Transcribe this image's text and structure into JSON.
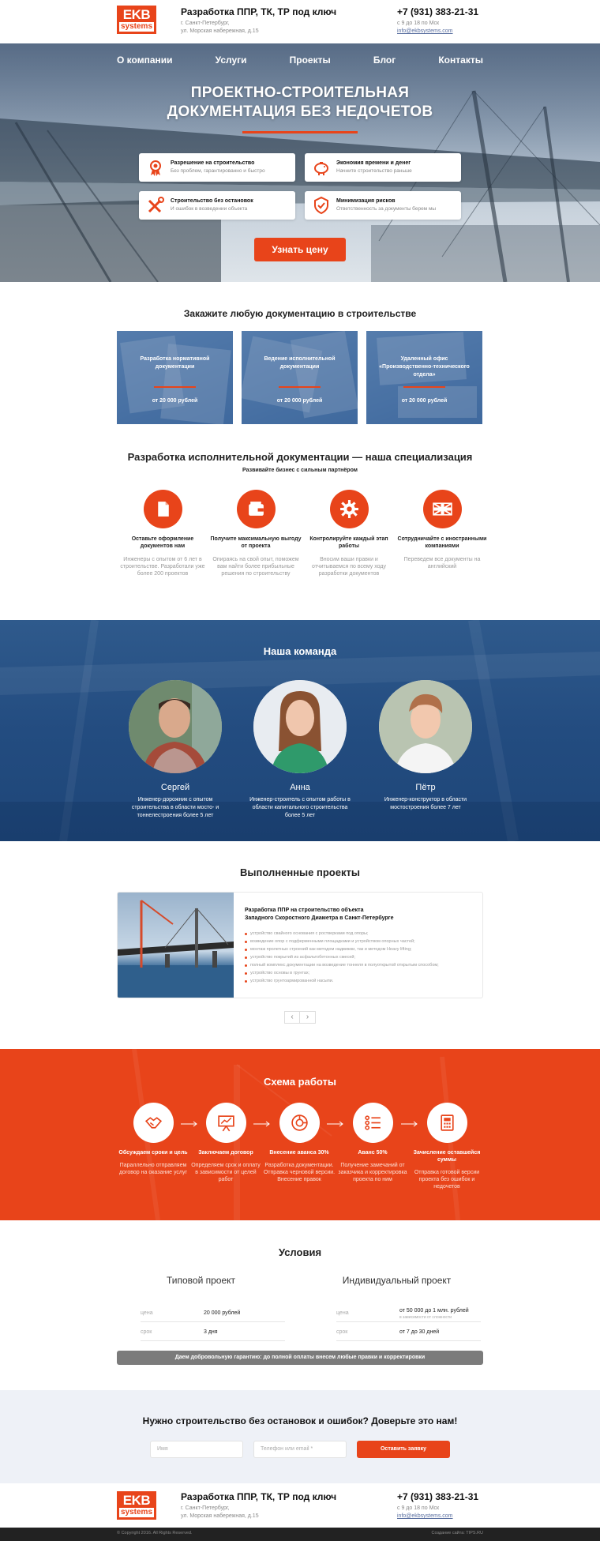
{
  "header": {
    "logo_top": "EKB",
    "logo_bottom": "systems",
    "title": "Разработка ППР, ТК, ТР под ключ",
    "city": "г. Санкт-Петербург,",
    "address": "ул. Морская набережная, д.15",
    "phone": "+7 (931) 383-21-31",
    "hours": "с 9 до 18 по Мск",
    "email": "info@ekbsystems.com"
  },
  "nav": [
    "О компании",
    "Услуги",
    "Проекты",
    "Блог",
    "Контакты"
  ],
  "hero": {
    "title_line1": "ПРОЕКТНО-СТРОИТЕЛЬНАЯ",
    "title_line2": "ДОКУМЕНТАЦИЯ БЕЗ НЕДОЧЕТОВ",
    "features": [
      {
        "title": "Разрешение на строительство",
        "sub": "Без проблем, гарантированно и быстро",
        "icon": "certificate-icon"
      },
      {
        "title": "Экономия времени и денег",
        "sub": "Начните строительство раньше",
        "icon": "piggy-bank-icon"
      },
      {
        "title": "Строительство без остановок",
        "sub": "И ошибок в возведении объекта",
        "icon": "tools-icon"
      },
      {
        "title": "Минимизация рисков",
        "sub": "Ответственность за документы берем мы",
        "icon": "shield-check-icon"
      }
    ],
    "cta": "Узнать цену"
  },
  "order": {
    "title": "Закажите любую документацию в строительстве",
    "cards": [
      {
        "name": "Разработка нормативной документации",
        "price": "от 20 000 рублей"
      },
      {
        "name": "Ведение исполнительной документации",
        "price": "от 20 000 рублей"
      },
      {
        "name": "Удаленный офис «Производственно-технического отдела»",
        "price": "от 20 000 рублей"
      }
    ]
  },
  "spec": {
    "title": "Разработка исполнительной документации — наша специализация",
    "subtitle": "Развивайте бизнес с сильным партнёром",
    "items": [
      {
        "title": "Оставьте оформление документов нам",
        "text": "Инженеры с опытом от 6 лет в строительстве. Разработали уже более 200 проектов",
        "icon": "document-icon"
      },
      {
        "title": "Получите максимальную выгоду от проекта",
        "text": "Опираясь на свой опыт, поможем вам найти более прибыльные решения по строительству",
        "icon": "wallet-icon"
      },
      {
        "title": "Контролируйте каждый этап работы",
        "text": "Вносим ваши правки и отчитываемся по всему ходу разработки документов",
        "icon": "gear-icon"
      },
      {
        "title": "Сотрудничайте с иностранными компаниями",
        "text": "Переведем все документы на английский",
        "icon": "uk-flag-icon"
      }
    ]
  },
  "team": {
    "title": "Наша команда",
    "members": [
      {
        "name": "Сергей",
        "desc": "Инженер-дорожник с опытом строительства в области мосто- и тоннелестроения более 5 лет"
      },
      {
        "name": "Анна",
        "desc": "Инженер-строитель с опытом работы в области капитального строительства более 5 лет"
      },
      {
        "name": "Пётр",
        "desc": "Инженер-конструктор в области мостостроения более 7 лет"
      }
    ]
  },
  "projects": {
    "title": "Выполненные проекты",
    "card_title_1": "Разработка ППР на строительство объекта",
    "card_title_2": "Западного Скоростного Диаметра в Санкт-Петербурге",
    "items": [
      "устройство свайного основания с ростверками под опоры;",
      "возведение опор с подферменными площадками и устройством опорных частей;",
      "монтаж пролетных строений как методом надвижки, так и методом Heavy lifting;",
      "устройство покрытий из асфальтобетонных смесей;",
      "полный комплекс документации на возведение тоннеля в полуоткрытой открытым способом;",
      "устройство основы в грунтах;",
      "устройство грунтоармированной насыпи."
    ],
    "prev": "‹",
    "next": "›"
  },
  "scheme": {
    "title": "Схема работы",
    "steps": [
      {
        "title": "Обсуждаем сроки и цель",
        "text": "Параллельно отправляем договор на оказание услуг",
        "icon": "handshake-icon"
      },
      {
        "title": "Заключаем договор",
        "text": "Определяем срок и оплату в зависимости от целей работ",
        "icon": "presentation-icon"
      },
      {
        "title": "Внесение аванса 30%",
        "text": "Разработка документации. Отправка черновой версии. Внесение правок",
        "icon": "pie-chart-icon"
      },
      {
        "title": "Аванс 50%",
        "text": "Получение замечаний от заказчика и корректировка проекта по ним",
        "icon": "checklist-icon"
      },
      {
        "title": "Зачисление оставшейся суммы",
        "text": "Отправка готовой версии проекта без ошибок и недочетов",
        "icon": "calculator-icon"
      }
    ]
  },
  "conditions": {
    "title": "Условия",
    "plans": [
      {
        "name": "Типовой проект",
        "price_label": "цена",
        "price": "20 000 рублей",
        "term_label": "срок",
        "term": "3 дня"
      },
      {
        "name": "Индивидуальный проект",
        "price_label": "цена",
        "price": "от 50 000 до 1 млн. рублей",
        "price_note": "в зависимости от сложности",
        "term_label": "срок",
        "term": "от 7 до 30 дней"
      }
    ],
    "guarantee": "Даем добровольную гарантию: до полной оплаты внесем любые правки и корректировки"
  },
  "form": {
    "title": "Нужно строительство без остановок и ошибок? Доверьте это нам!",
    "name_placeholder": "Имя",
    "contact_placeholder": "Телефон или email *",
    "submit": "Оставить заявку"
  },
  "footer": {
    "copyright": "© Copyright 2016. All Rights Reserved.",
    "credit": "Создание сайта: TIPS.RU"
  },
  "colors": {
    "accent": "#e8441a",
    "team_bg": "#234c80",
    "form_bg": "#eef1f7"
  }
}
